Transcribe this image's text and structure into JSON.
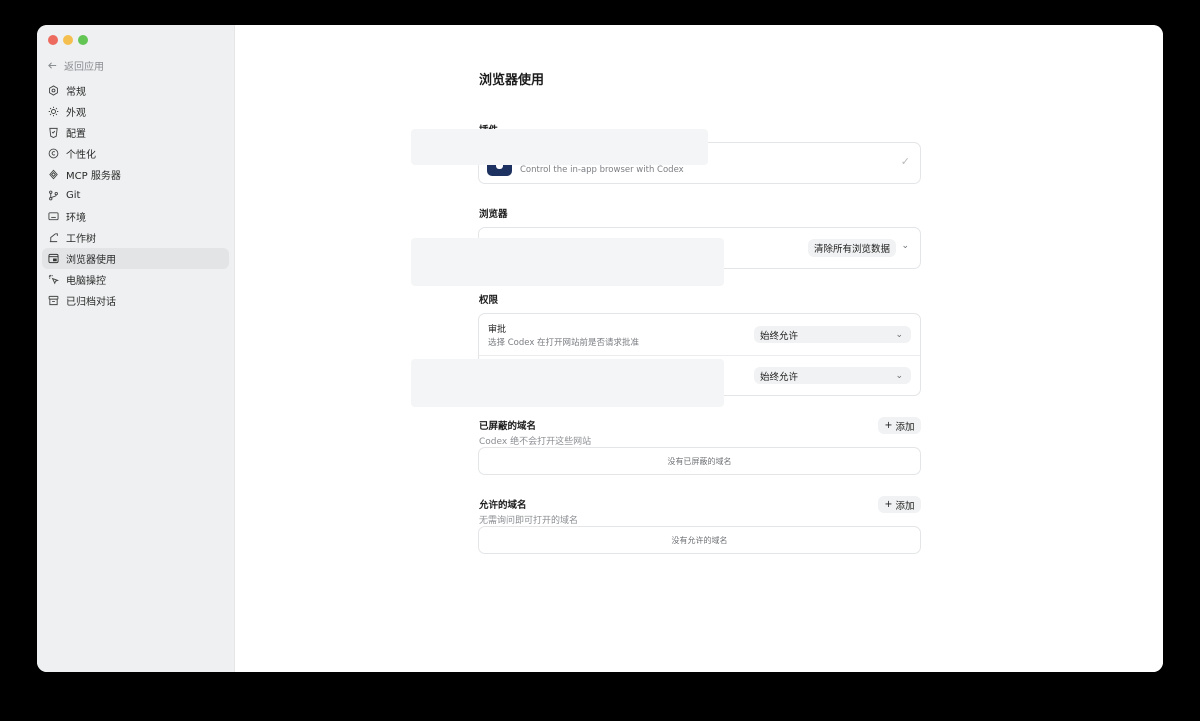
{
  "sidebar": {
    "back_label": "返回应用",
    "items": [
      {
        "label": "常规",
        "icon": "gear-icon"
      },
      {
        "label": "外观",
        "icon": "sun-icon"
      },
      {
        "label": "配置",
        "icon": "config-icon"
      },
      {
        "label": "个性化",
        "icon": "personalize-icon"
      },
      {
        "label": "MCP 服务器",
        "icon": "mcp-icon"
      },
      {
        "label": "Git",
        "icon": "git-branch-icon"
      },
      {
        "label": "环境",
        "icon": "monitor-icon"
      },
      {
        "label": "工作树",
        "icon": "worktree-icon"
      },
      {
        "label": "浏览器使用",
        "icon": "browser-icon"
      },
      {
        "label": "电脑操控",
        "icon": "pointer-icon"
      },
      {
        "label": "已归档对话",
        "icon": "archive-icon"
      }
    ]
  },
  "main": {
    "title": "浏览器使用",
    "plugin_section": {
      "label": "插件",
      "plugin_description": "Control the in-app browser with Codex",
      "icon": "codex-plugin-icon"
    },
    "browser_section": {
      "label": "浏览器",
      "clear_button": "清除所有浏览数据"
    },
    "permissions_section": {
      "label": "权限",
      "approval_title": "审批",
      "approval_sub": "选择 Codex 在打开网站前是否请求批准",
      "approval_value": "始终允许",
      "second_value": "始终允许"
    },
    "blocked": {
      "title": "已屏蔽的域名",
      "sub": "Codex 绝不会打开这些网站",
      "add_label": "添加",
      "empty": "没有已屏蔽的域名"
    },
    "allowed": {
      "title": "允许的域名",
      "sub": "无需询问即可打开的域名",
      "add_label": "添加",
      "empty": "没有允许的域名"
    }
  }
}
